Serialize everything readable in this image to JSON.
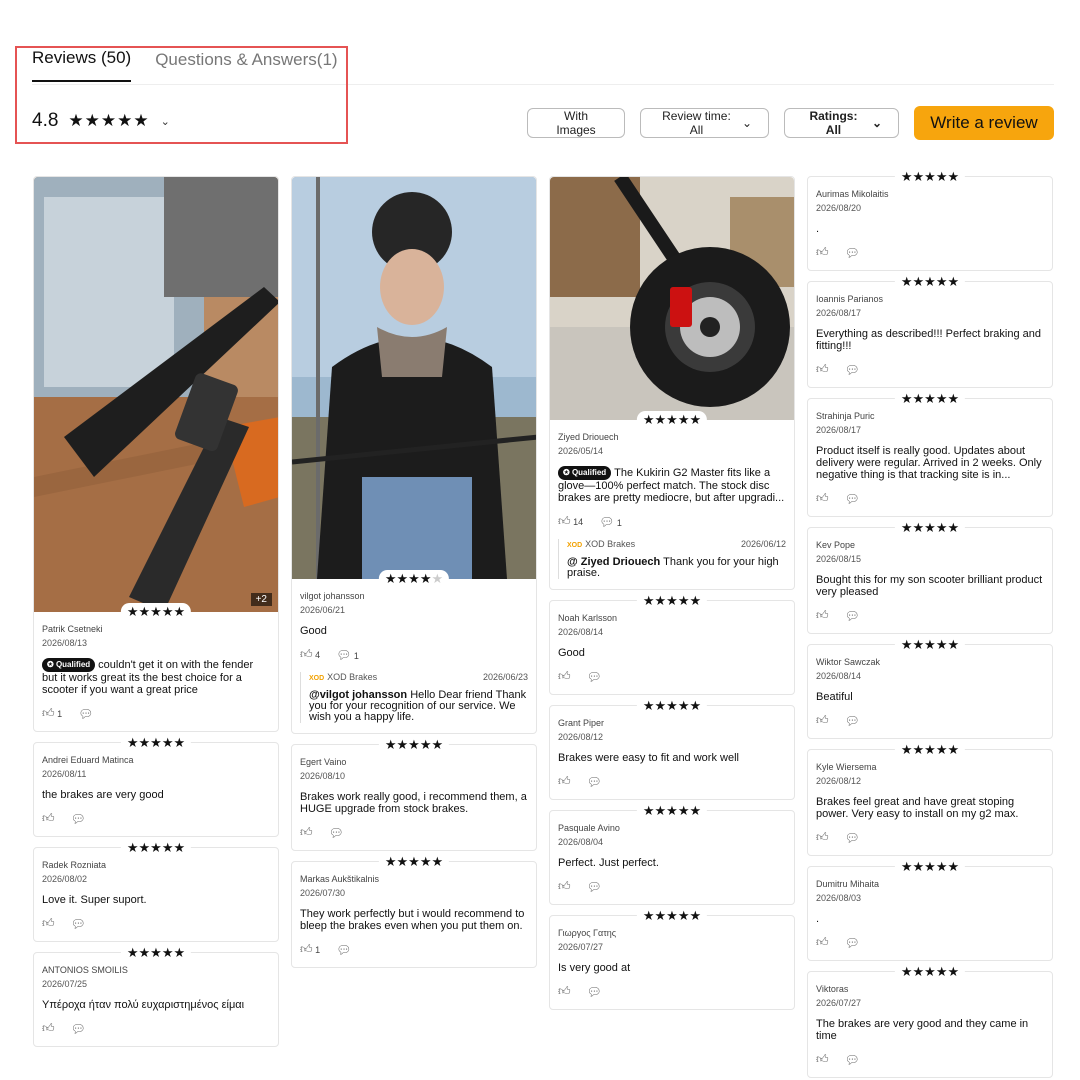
{
  "tabs": [
    {
      "label": "Reviews (50)",
      "active": true
    },
    {
      "label": "Questions & Answers(1)",
      "active": false
    }
  ],
  "rating": {
    "value": "4.8",
    "stars": 4.8
  },
  "filters": {
    "with_images": "With Images",
    "review_time": "Review time: All",
    "ratings": "Ratings: All",
    "write_review": "Write a review"
  },
  "colors": {
    "accent": "#f7a50d",
    "highlight": "#e55353",
    "brand": "#f2a100"
  },
  "reviews": {
    "c1": [
      {
        "name": "Patrik Csetneki",
        "date": "2026/08/13",
        "stars": 5,
        "qualified": "Qualified",
        "text": "couldn't get it on with the fender but it works great its the best choice for a scooter if you want a great price",
        "likes": "1",
        "comments": "",
        "photo": "handlebar",
        "photo_more": "+2"
      },
      {
        "name": "Andrei Eduard Matinca",
        "date": "2026/08/11",
        "stars": 5,
        "text": "the brakes are very good"
      },
      {
        "name": "Radek Rozniata",
        "date": "2026/08/02",
        "stars": 5,
        "text": "Love it. Super suport."
      },
      {
        "name": "ANTONIOS SMOILIS",
        "date": "2026/07/25",
        "stars": 5,
        "text": "Υπέροχα ήταν πολύ ευχαριστημένος είμαι"
      }
    ],
    "c2": [
      {
        "name": "vilgot johansson",
        "date": "2026/06/21",
        "stars": 4,
        "text": "Good",
        "likes": "4",
        "comments": "1",
        "photo": "rider",
        "reply": {
          "brand": "XOD Brakes",
          "brand_mark": "XOD",
          "date": "2026/06/23",
          "mention": "@vilgot johansson",
          "text_first": "Hello",
          "text_rest": "Dear friend Thank you for your recognition of our service. We wish you a happy life."
        }
      },
      {
        "name": "Egert Vaino",
        "date": "2026/08/10",
        "stars": 5,
        "text": "Brakes work really good, i recommend them, a HUGE upgrade from stock brakes."
      },
      {
        "name": "Markas Aukštikalnis",
        "date": "2026/07/30",
        "stars": 5,
        "text": "They work perfectly but i would recommend to bleep the brakes even when you put them on.",
        "likes": "1"
      }
    ],
    "c3": [
      {
        "name": "Ziyed Driouech",
        "date": "2026/05/14",
        "stars": 5,
        "qualified": "Qualified",
        "text": "The Kukirin G2 Master fits like a glove—100% perfect match. The stock disc brakes are pretty mediocre, but after upgradi...",
        "likes": "14",
        "comments": "1",
        "photo": "wheel",
        "reply": {
          "brand": "XOD Brakes",
          "brand_mark": "XOD",
          "date": "2026/06/12",
          "mention": "@ Ziyed Driouech",
          "text_first": "Thank you for your high praise.",
          "text_rest": ""
        }
      },
      {
        "name": "Noah Karlsson",
        "date": "2026/08/14",
        "stars": 5,
        "text": "Good"
      },
      {
        "name": "Grant Piper",
        "date": "2026/08/12",
        "stars": 5,
        "text": "Brakes were easy to fit and work well"
      },
      {
        "name": "Pasquale Avino",
        "date": "2026/08/04",
        "stars": 5,
        "text": "Perfect. Just perfect."
      },
      {
        "name": "Γιωργος Γατης",
        "date": "2026/07/27",
        "stars": 5,
        "text": "Is very good at"
      }
    ],
    "c4": [
      {
        "name": "Aurimas Mikolaitis",
        "date": "2026/08/20",
        "stars": 5,
        "text": "."
      },
      {
        "name": "Ioannis Parianos",
        "date": "2026/08/17",
        "stars": 5,
        "text": "Everything as described!!! Perfect braking and fitting!!!"
      },
      {
        "name": "Strahinja Puric",
        "date": "2026/08/17",
        "stars": 5,
        "text": "Product itself is really good. Updates about delivery were regular. Arrived in 2 weeks. Only negative thing is that tracking site is in..."
      },
      {
        "name": "Kev Pope",
        "date": "2026/08/15",
        "stars": 5,
        "text": "Bought this for my son scooter brilliant product very pleased"
      },
      {
        "name": "Wiktor Sawczak",
        "date": "2026/08/14",
        "stars": 5,
        "text": "Beatiful"
      },
      {
        "name": "Kyle Wiersema",
        "date": "2026/08/12",
        "stars": 5,
        "text": "Brakes feel great and have great stoping power. Very easy to install on my g2 max."
      },
      {
        "name": "Dumitru Mihaita",
        "date": "2026/08/03",
        "stars": 5,
        "text": "."
      },
      {
        "name": "Viktoras",
        "date": "2026/07/27",
        "stars": 5,
        "text": "The brakes are very good and they came in time"
      }
    ]
  }
}
